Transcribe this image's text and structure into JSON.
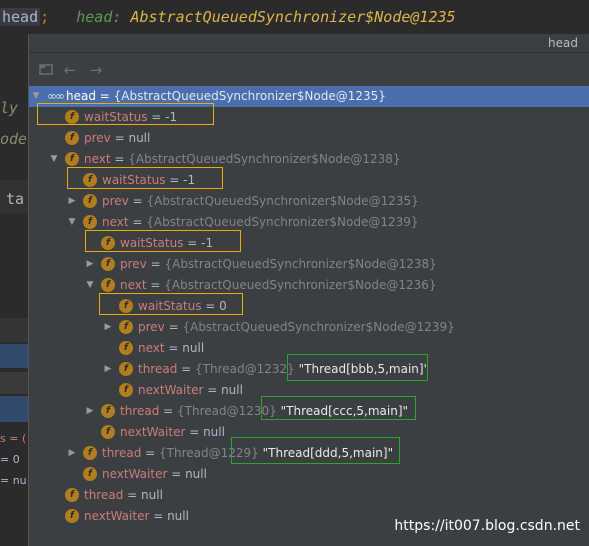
{
  "editor": {
    "head_token": "head",
    "semicolon": ";",
    "hint_name": "head:",
    "hint_value": "AbstractQueuedSynchronizer$Node@1235",
    "frag_1": "ly",
    "frag_2": "ode",
    "frag_3": "ta",
    "frag_4": "s = (",
    "frag_5": "= 0",
    "frag_6": "= nu"
  },
  "popup": {
    "title": "head",
    "toolbar": {
      "icons": [
        "view-icon",
        "back-arrow-icon",
        "forward-arrow-icon"
      ]
    }
  },
  "tree": [
    {
      "id": "r0",
      "expand": "down",
      "icon": "oo",
      "name": "head",
      "eq": " = ",
      "type": "{AbstractQueuedSynchronizer$Node@1235}",
      "value": ""
    },
    {
      "id": "r1",
      "expand": "",
      "icon": "f",
      "name": "waitStatus",
      "eq": " = ",
      "type": "",
      "value": "-1"
    },
    {
      "id": "r2",
      "expand": "",
      "icon": "f",
      "name": "prev",
      "eq": " = ",
      "type": "",
      "value": "null"
    },
    {
      "id": "r3",
      "expand": "down",
      "icon": "f",
      "name": "next",
      "eq": " = ",
      "type": "{AbstractQueuedSynchronizer$Node@1238}",
      "value": ""
    },
    {
      "id": "r4",
      "expand": "",
      "icon": "f",
      "name": "waitStatus",
      "eq": " = ",
      "type": "",
      "value": "-1"
    },
    {
      "id": "r5",
      "expand": "right",
      "icon": "f",
      "name": "prev",
      "eq": " = ",
      "type": "{AbstractQueuedSynchronizer$Node@1235}",
      "value": ""
    },
    {
      "id": "r6",
      "expand": "down",
      "icon": "f",
      "name": "next",
      "eq": " = ",
      "type": "{AbstractQueuedSynchronizer$Node@1239}",
      "value": ""
    },
    {
      "id": "r7",
      "expand": "",
      "icon": "f",
      "name": "waitStatus",
      "eq": " = ",
      "type": "",
      "value": "-1"
    },
    {
      "id": "r8",
      "expand": "right",
      "icon": "f",
      "name": "prev",
      "eq": " = ",
      "type": "{AbstractQueuedSynchronizer$Node@1238}",
      "value": ""
    },
    {
      "id": "r9",
      "expand": "down",
      "icon": "f",
      "name": "next",
      "eq": " = ",
      "type": "{AbstractQueuedSynchronizer$Node@1236}",
      "value": ""
    },
    {
      "id": "r10",
      "expand": "",
      "icon": "f",
      "name": "waitStatus",
      "eq": " = ",
      "type": "",
      "value": "0"
    },
    {
      "id": "r11",
      "expand": "right",
      "icon": "f",
      "name": "prev",
      "eq": " = ",
      "type": "{AbstractQueuedSynchronizer$Node@1239}",
      "value": ""
    },
    {
      "id": "r12",
      "expand": "",
      "icon": "f",
      "name": "next",
      "eq": " = ",
      "type": "",
      "value": "null"
    },
    {
      "id": "r13",
      "expand": "right",
      "icon": "f",
      "name": "thread",
      "eq": " = ",
      "type": "{Thread@1232}",
      "value": "\"Thread[bbb,5,main]\""
    },
    {
      "id": "r14",
      "expand": "",
      "icon": "f",
      "name": "nextWaiter",
      "eq": " = ",
      "type": "",
      "value": "null"
    },
    {
      "id": "r15",
      "expand": "right",
      "icon": "f",
      "name": "thread",
      "eq": " = ",
      "type": "{Thread@1230}",
      "value": "\"Thread[ccc,5,main]\""
    },
    {
      "id": "r16",
      "expand": "",
      "icon": "f",
      "name": "nextWaiter",
      "eq": " = ",
      "type": "",
      "value": "null"
    },
    {
      "id": "r17",
      "expand": "right",
      "icon": "f",
      "name": "thread",
      "eq": " = ",
      "type": "{Thread@1229}",
      "value": "\"Thread[ddd,5,main]\""
    },
    {
      "id": "r18",
      "expand": "",
      "icon": "f",
      "name": "nextWaiter",
      "eq": " = ",
      "type": "",
      "value": "null"
    },
    {
      "id": "r19",
      "expand": "",
      "icon": "f",
      "name": "thread",
      "eq": " = ",
      "type": "",
      "value": "null"
    },
    {
      "id": "r20",
      "expand": "",
      "icon": "f",
      "name": "nextWaiter",
      "eq": " = ",
      "type": "",
      "value": "null"
    }
  ],
  "field_icon_letter": "f",
  "object_icon": "∞",
  "watermark": "https://it007.blog.csdn.net",
  "colors": {
    "selection": "#4b6eaf",
    "highlight_yellow": "#e6b000",
    "highlight_green": "#2ea42e",
    "field_icon": "#b07d1f"
  }
}
